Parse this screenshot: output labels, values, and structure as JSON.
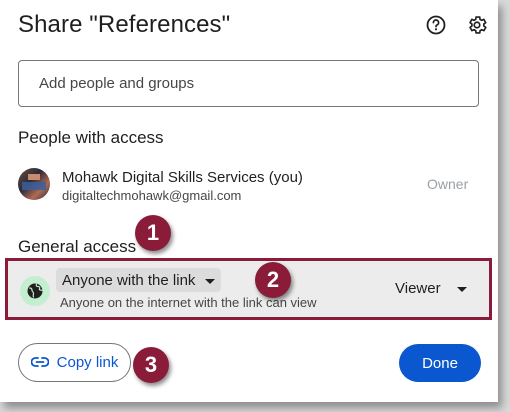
{
  "dialog": {
    "title": "Share \"References\"",
    "help_icon": "help-circle-icon",
    "settings_icon": "gear-icon"
  },
  "add_people": {
    "placeholder": "Add people and groups"
  },
  "people_section": {
    "label": "People with access",
    "people": [
      {
        "name": "Mohawk Digital Skills Services (you)",
        "email": "digitaltechmohawk@gmail.com",
        "role": "Owner"
      }
    ]
  },
  "general_access": {
    "label": "General access",
    "icon": "globe-icon",
    "selected": "Anyone with the link",
    "description": "Anyone on the internet with the link can view",
    "role": "Viewer"
  },
  "actions": {
    "copy_link": "Copy link",
    "copy_icon": "link-icon",
    "done": "Done"
  },
  "annotations": [
    "1",
    "2",
    "3"
  ],
  "colors": {
    "accent": "#0b57d0",
    "annotation": "#8a1c3a",
    "globe_bg": "#c4eed0"
  }
}
